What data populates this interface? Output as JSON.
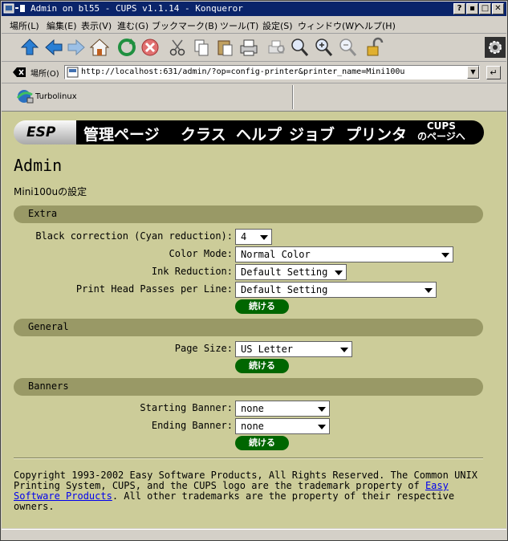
{
  "window": {
    "title": "Admin on bl55 - CUPS v1.1.14 - Konqueror",
    "buttons": [
      "?",
      "▪",
      "□",
      "✕"
    ]
  },
  "menubar": {
    "items": [
      "場所(L)",
      "編集(E)",
      "表示(V)",
      "進む(G)",
      "ブックマーク(B)",
      "ツール(T)",
      "設定(S)",
      "ウィンドウ(W)",
      "ヘルプ(H)"
    ]
  },
  "toolbar": {
    "icons": [
      "up-arrow-icon",
      "back-arrow-icon",
      "forward-arrow-icon",
      "home-icon",
      "reload-icon",
      "stop-icon",
      "cut-icon",
      "copy-icon",
      "paste-icon",
      "print-icon",
      "print-preview-icon",
      "zoom-icon",
      "zoom-in-icon",
      "zoom-out-icon",
      "lock-icon"
    ]
  },
  "location": {
    "label": "場所(O)",
    "url": "http://localhost:631/admin/?op=config-printer&printer_name=Mini100u"
  },
  "bookmarks": {
    "item": "Turbolinux"
  },
  "banner": {
    "esp": "ESP",
    "links": [
      "管理ページ",
      "クラス",
      "ヘルプ",
      "ジョブ",
      "プリンタ"
    ],
    "cups_line1": "CUPS",
    "cups_line2": "のページへ"
  },
  "page": {
    "heading": "Admin",
    "subtitle": "Mini100uの設定"
  },
  "sections": {
    "extra": {
      "title": "Extra",
      "black_correction_label": "Black correction (Cyan reduction):",
      "black_correction_value": "4",
      "color_mode_label": "Color Mode:",
      "color_mode_value": "Normal Color",
      "ink_reduction_label": "Ink Reduction:",
      "ink_reduction_value": "Default Setting",
      "head_passes_label": "Print Head Passes per Line:",
      "head_passes_value": "Default Setting",
      "continue": "続ける"
    },
    "general": {
      "title": "General",
      "page_size_label": "Page Size:",
      "page_size_value": "US Letter",
      "continue": "続ける"
    },
    "banners": {
      "title": "Banners",
      "starting_label": "Starting Banner:",
      "starting_value": "none",
      "ending_label": "Ending Banner:",
      "ending_value": "none",
      "continue": "続ける"
    }
  },
  "footer": {
    "text1": "Copyright 1993-2002 Easy Software Products, All Rights Reserved. The Common UNIX Printing System, CUPS, and the CUPS logo are the trademark property of ",
    "link": "Easy Software Products",
    "text2": ". All other trademarks are the property of their respective owners."
  }
}
